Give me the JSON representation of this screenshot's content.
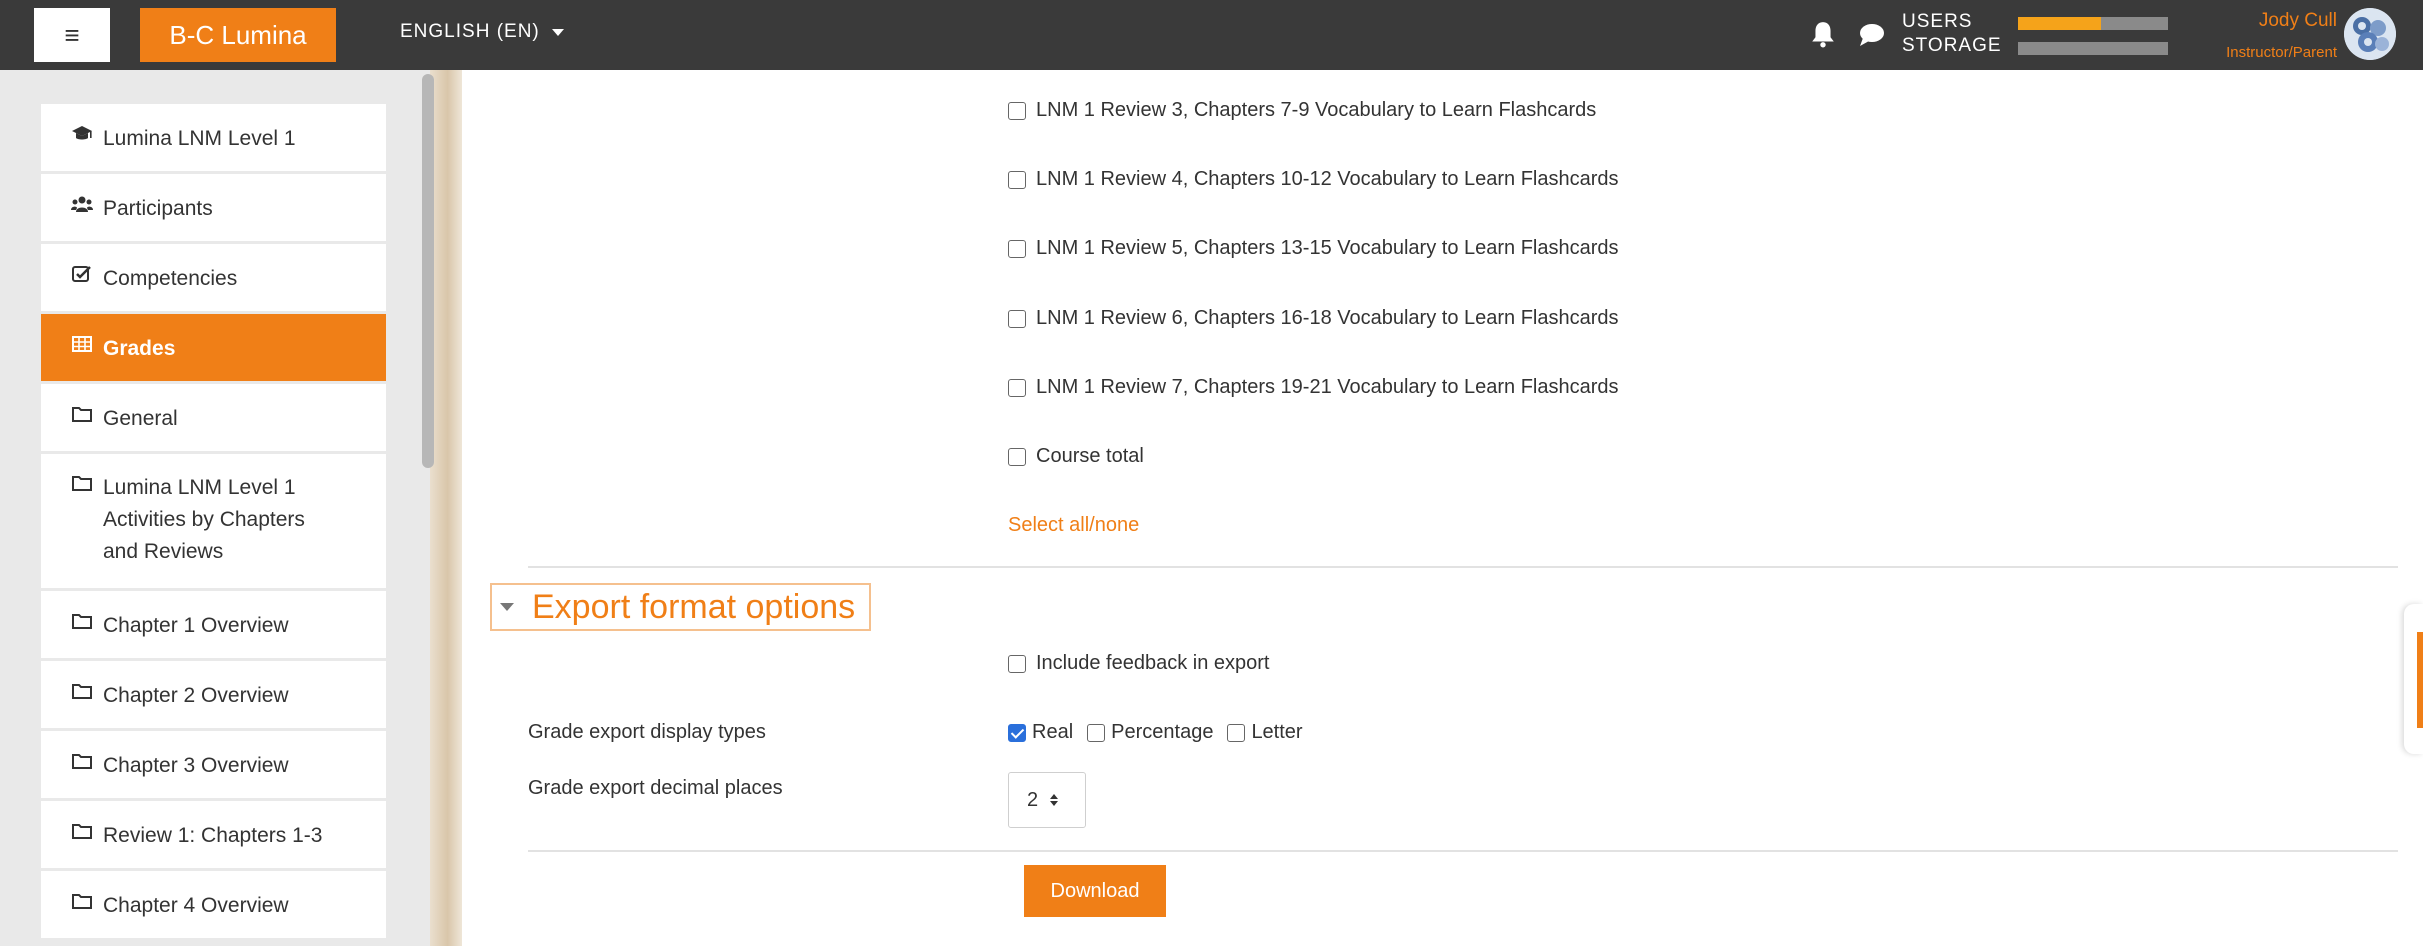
{
  "header": {
    "menu_icon": "hamburger-icon",
    "brand": "B-C Lumina",
    "language": "ENGLISH (EN)",
    "notifications_icon": "bell-icon",
    "messages_icon": "chat-bubble-icon",
    "usage": {
      "users_label": "USERS",
      "storage_label": "STORAGE",
      "users_fraction": 0.55,
      "storage_fraction": 0.0
    },
    "user": {
      "name": "Jody Cull",
      "role": "Instructor/Parent",
      "avatar_icon": "avatar-icon"
    },
    "colors": {
      "navbar": "#3a3a3a",
      "accent": "#f07f17"
    }
  },
  "sidebar": {
    "items": [
      {
        "label": "Lumina LNM Level 1",
        "icon": "graduation-cap-icon",
        "active": false
      },
      {
        "label": "Participants",
        "icon": "users-icon",
        "active": false
      },
      {
        "label": "Competencies",
        "icon": "checkbox-icon",
        "active": false
      },
      {
        "label": "Grades",
        "icon": "table-icon",
        "active": true
      },
      {
        "label": "General",
        "icon": "folder-icon",
        "active": false
      },
      {
        "label": "Lumina LNM Level 1 Activities by Chapters and Reviews",
        "label_lines": [
          "Lumina LNM Level 1",
          "Activities by Chapters",
          "and Reviews"
        ],
        "icon": "folder-icon",
        "active": false
      },
      {
        "label": "Chapter 1 Overview",
        "icon": "folder-icon",
        "active": false
      },
      {
        "label": "Chapter 2 Overview",
        "icon": "folder-icon",
        "active": false
      },
      {
        "label": "Chapter 3 Overview",
        "icon": "folder-icon",
        "active": false
      },
      {
        "label": "Review 1: Chapters 1-3",
        "icon": "folder-icon",
        "active": false
      },
      {
        "label": "Chapter 4 Overview",
        "icon": "folder-icon",
        "active": false
      }
    ]
  },
  "grade_items": [
    {
      "label": "LNM 1 Review 3, Chapters 7-9 Vocabulary to Learn Flashcards",
      "checked": false
    },
    {
      "label": "LNM 1 Review 4, Chapters 10-12 Vocabulary to Learn Flashcards",
      "checked": false
    },
    {
      "label": "LNM 1 Review 5, Chapters 13-15 Vocabulary to Learn Flashcards",
      "checked": false
    },
    {
      "label": "LNM 1 Review 6, Chapters 16-18 Vocabulary to Learn Flashcards",
      "checked": false
    },
    {
      "label": "LNM 1 Review 7, Chapters 19-21 Vocabulary to Learn Flashcards",
      "checked": false
    },
    {
      "label": "Course total",
      "checked": false
    }
  ],
  "select_all_link": "Select all/none",
  "export_options": {
    "section_title": "Export format options",
    "include_feedback": {
      "label": "Include feedback in export",
      "checked": false
    },
    "display_types": {
      "label": "Grade export display types",
      "options": [
        {
          "label": "Real",
          "checked": true
        },
        {
          "label": "Percentage",
          "checked": false
        },
        {
          "label": "Letter",
          "checked": false
        }
      ]
    },
    "decimal_places": {
      "label": "Grade export decimal places",
      "value": "2"
    }
  },
  "download_button": "Download"
}
